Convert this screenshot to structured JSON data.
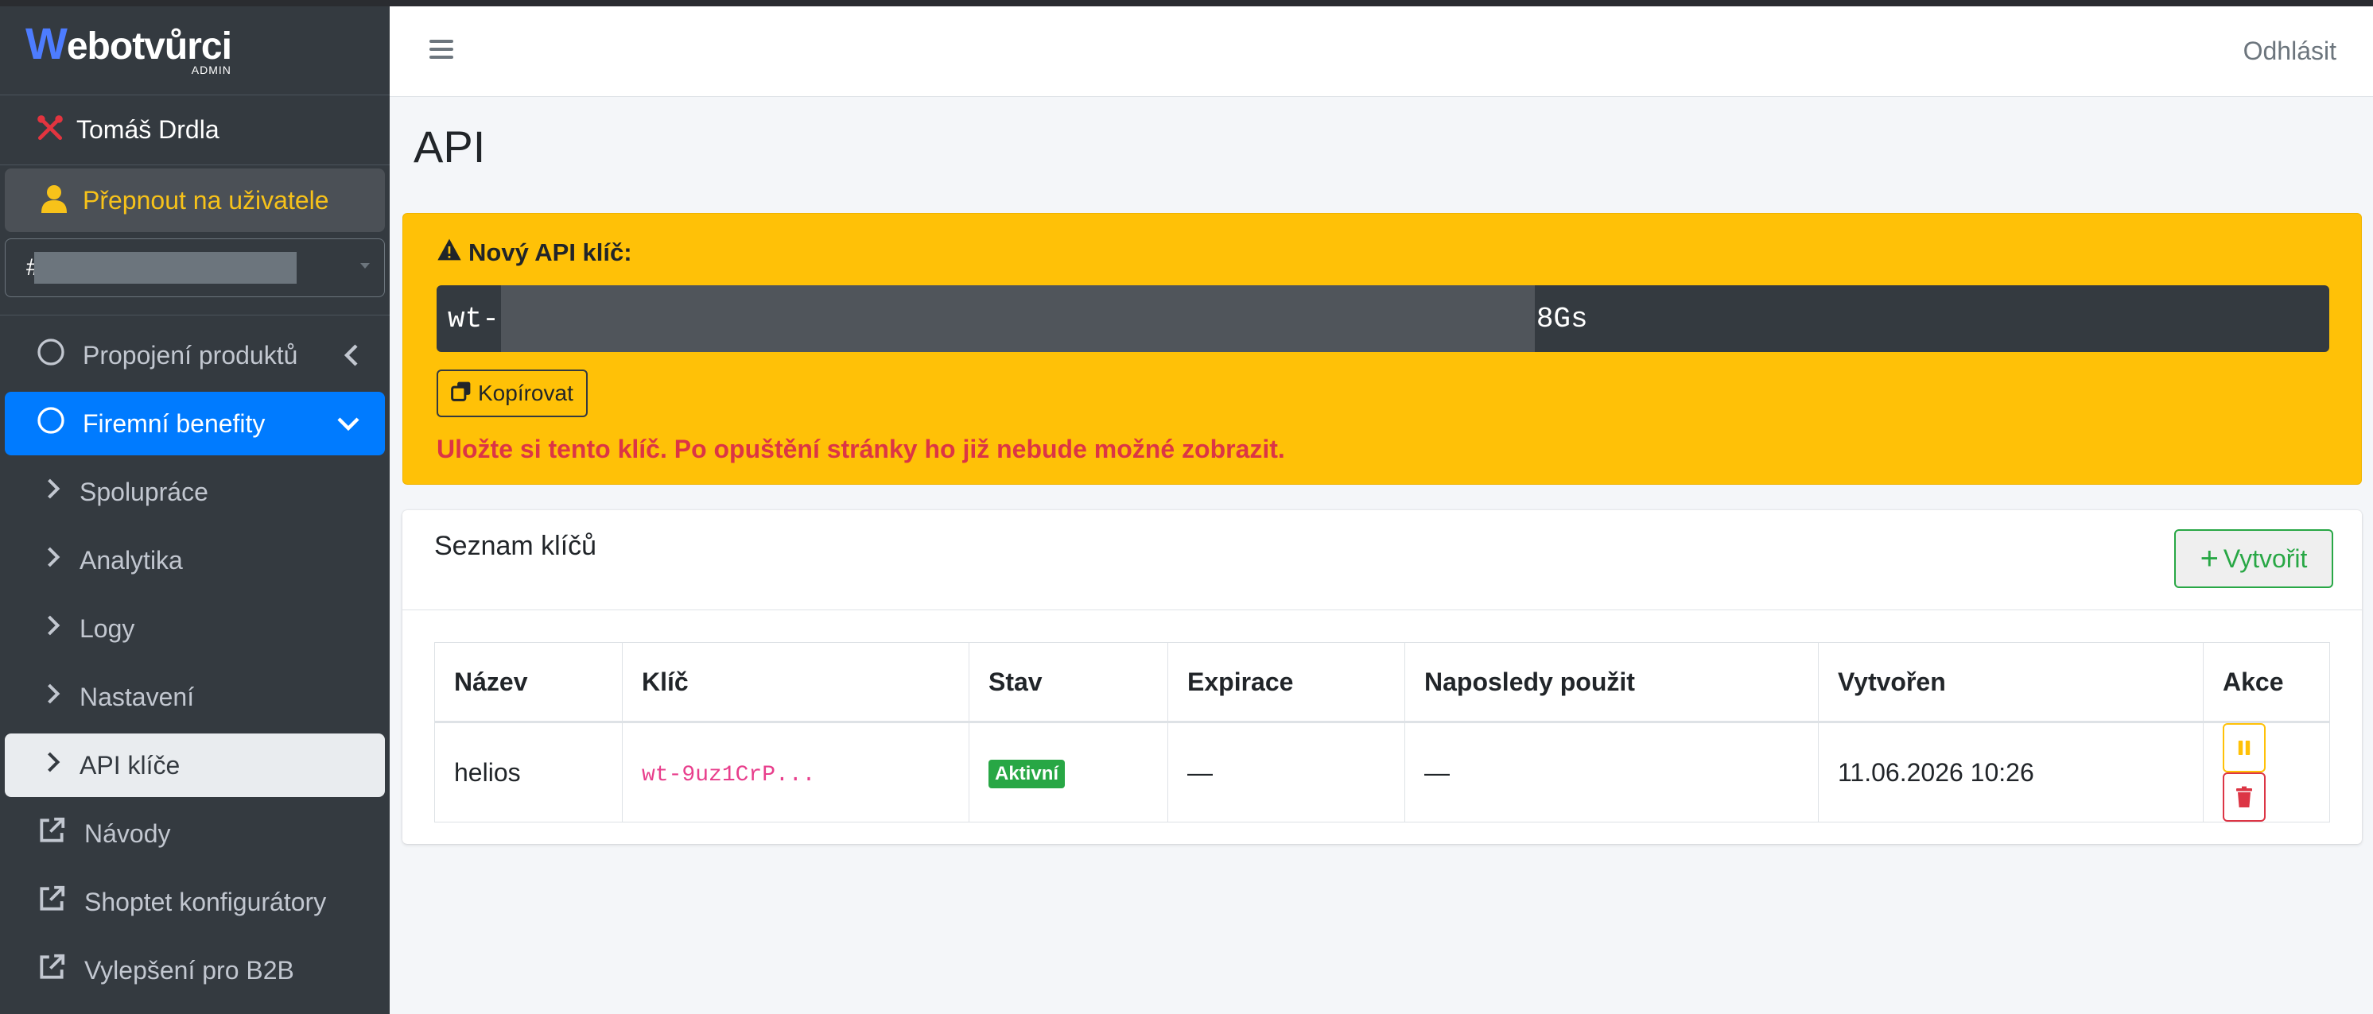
{
  "brand": {
    "name_w": "W",
    "name_rest": "ebotvůrci",
    "sub": "ADMIN"
  },
  "sidebar": {
    "user": {
      "name": "Tomáš Drdla",
      "icon": "tools-icon"
    },
    "switch_user": "Přepnout na uživatele",
    "shop_select": {
      "value": "#"
    },
    "items": [
      {
        "label": "Propojení produktů",
        "icon": "circle-icon",
        "end": "chevron-left"
      },
      {
        "label": "Firemní benefity",
        "icon": "circle-icon",
        "end": "chevron-down",
        "active": true
      },
      {
        "label": "Spolupráce",
        "icon": "chevron-right-icon"
      },
      {
        "label": "Analytika",
        "icon": "chevron-right-icon"
      },
      {
        "label": "Logy",
        "icon": "chevron-right-icon"
      },
      {
        "label": "Nastavení",
        "icon": "chevron-right-icon"
      },
      {
        "label": "API klíče",
        "icon": "chevron-right-icon",
        "current": true
      },
      {
        "label": "Návody",
        "icon": "external-link-icon"
      },
      {
        "label": "Shoptet konfigurátory",
        "icon": "external-link-icon"
      },
      {
        "label": "Vylepšení pro B2B",
        "icon": "external-link-icon"
      }
    ]
  },
  "header": {
    "logout": "Odhlásit"
  },
  "page": {
    "title": "API"
  },
  "alert": {
    "title": "Nový API klíč:",
    "key_prefix": "wt-",
    "key_suffix": "8Gs",
    "copy_label": "Kopírovat",
    "warning": "Uložte si tento klíč. Po opuštění stránky ho již nebude možné zobrazit."
  },
  "keys_card": {
    "title": "Seznam klíčů",
    "create_label": "Vytvořit",
    "columns": [
      "Název",
      "Klíč",
      "Stav",
      "Expirace",
      "Naposledy použit",
      "Vytvořen",
      "Akce"
    ],
    "rows": [
      {
        "name": "helios",
        "key": "wt-9uz1CrP...",
        "status": "Aktivní",
        "expiration": "—",
        "last_used": "—",
        "created": "11.06.2026 10:26"
      }
    ]
  },
  "colors": {
    "accent": "#007bff",
    "warning": "#ffc107",
    "danger": "#dc3545",
    "success": "#28a745",
    "sidebar": "#343a40"
  }
}
